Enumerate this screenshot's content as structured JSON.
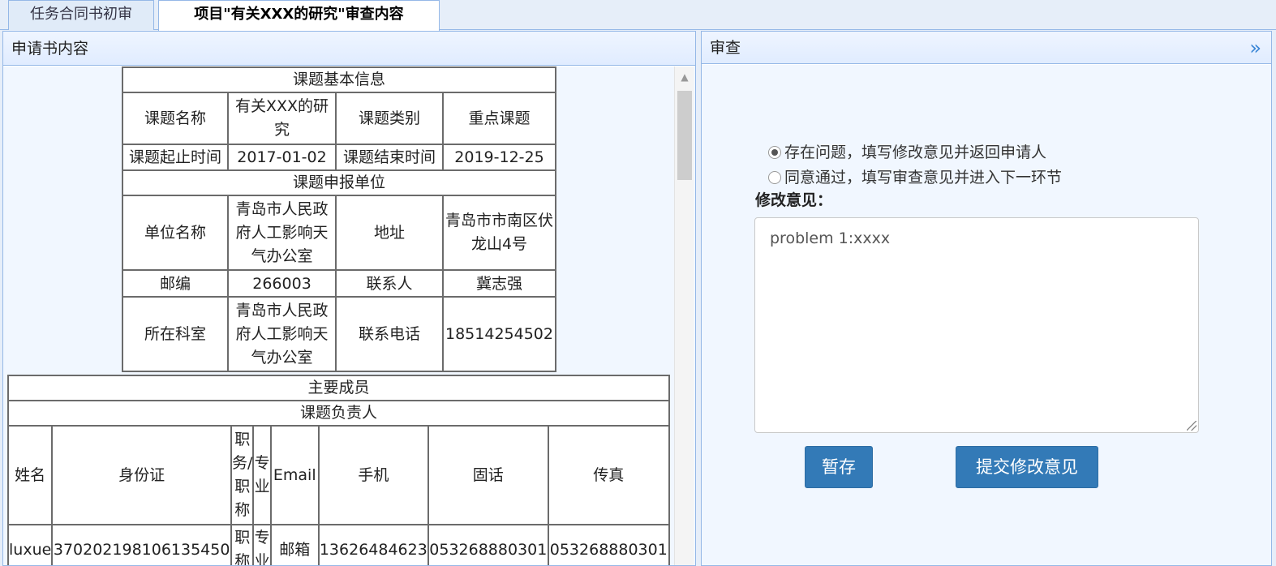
{
  "tabs": [
    "任务合同书初审",
    "项目\"有关XXX的研究\"审查内容"
  ],
  "left_panel": {
    "title": "申请书内容",
    "basic_info": {
      "section": "课题基本信息",
      "name_label": "课题名称",
      "name_value": "有关XXX的研究",
      "category_label": "课题类别",
      "category_value": "重点课题",
      "start_label": "课题起止时间",
      "start_value": "2017-01-02",
      "end_label": "课题结束时间",
      "end_value": "2019-12-25"
    },
    "unit_info": {
      "section": "课题申报单位",
      "unit_name_label": "单位名称",
      "unit_name_value": "青岛市人民政府人工影响天气办公室",
      "address_label": "地址",
      "address_value": "青岛市市南区伏龙山4号",
      "zip_label": "邮编",
      "zip_value": "266003",
      "contact_label": "联系人",
      "contact_value": "冀志强",
      "dept_label": "所在科室",
      "dept_value": "青岛市人民政府人工影响天气办公室",
      "phone_label": "联系电话",
      "phone_value": "18514254502"
    },
    "members": {
      "section": "主要成员",
      "subsection": "课题负责人",
      "headers": [
        "姓名",
        "身份证",
        "职务/职称",
        "专业",
        "Email",
        "手机",
        "固话",
        "传真"
      ],
      "rows": [
        [
          "luxue",
          "370202198106135450",
          "职称",
          "专业",
          "邮箱",
          "13626484623",
          "053268880301",
          "053268880301"
        ]
      ]
    }
  },
  "right_panel": {
    "title": "审查",
    "option_reject": "存在问题，填写修改意见并返回申请人",
    "option_approve": "同意通过，填写审查意见并进入下一环节",
    "opinion_label": "修改意见：",
    "opinion_value": "problem 1:xxxx",
    "save_button": "暂存",
    "submit_button": "提交修改意见",
    "selected_option": "option_reject"
  }
}
